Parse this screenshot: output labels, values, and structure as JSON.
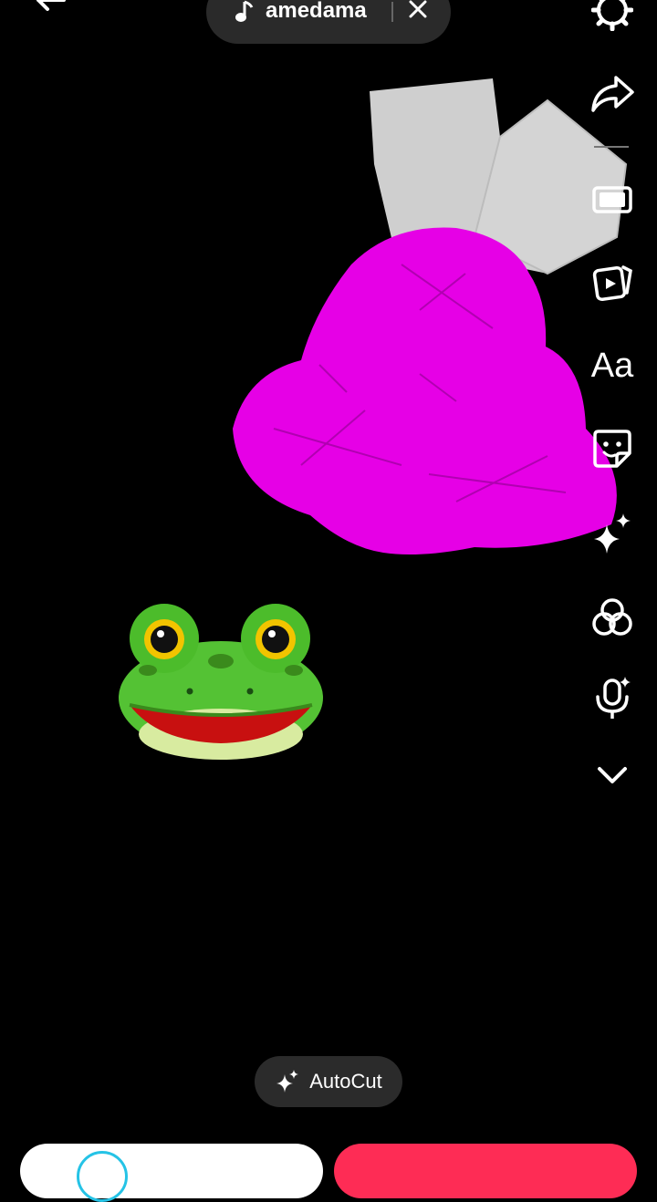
{
  "music": {
    "title": "amedama"
  },
  "rail": {
    "text_label": "Aa"
  },
  "autocut": {
    "label": "AutoCut"
  },
  "icons": {
    "back": "back-arrow-icon",
    "note": "music-note-icon",
    "close": "close-icon",
    "settings": "settings-icon",
    "share": "share-icon",
    "aspect": "aspect-ratio-icon",
    "templates": "templates-icon",
    "text": "text-icon",
    "stickers": "sticker-icon",
    "effects": "effects-icon",
    "filters": "filters-icon",
    "voice": "voice-effects-icon",
    "more": "chevron-down-icon",
    "sparkle": "sparkle-icon"
  },
  "colors": {
    "accent": "#fe2c55",
    "sticker_magenta": "#e600e6",
    "sticker_gray": "#cfcfcf",
    "frog": "#4cbc2b"
  }
}
